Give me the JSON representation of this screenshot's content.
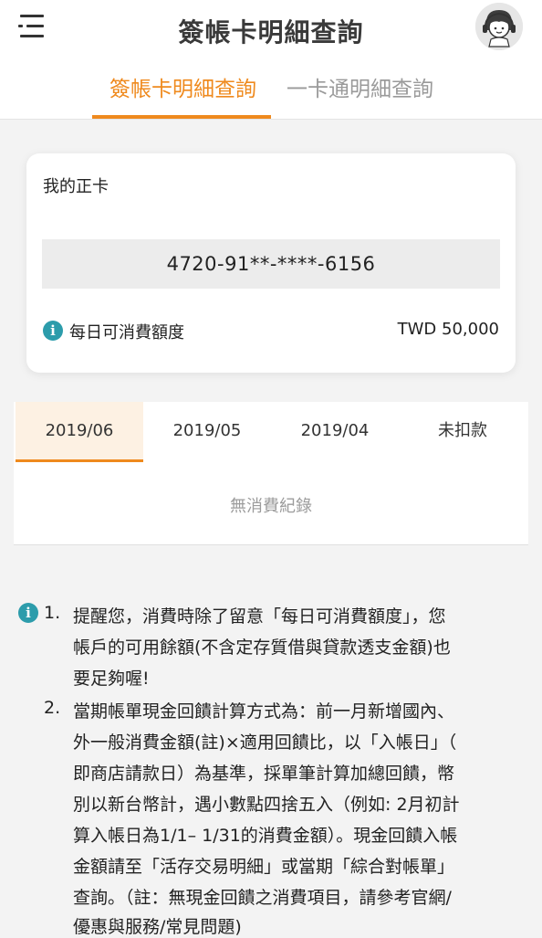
{
  "header": {
    "title": "簽帳卡明細查詢",
    "menu_icon": "menu-icon",
    "avatar_icon": "customer-service-avatar-icon"
  },
  "tabs": [
    {
      "label": "簽帳卡明細查詢",
      "active": true
    },
    {
      "label": "一卡通明細查詢",
      "active": false
    }
  ],
  "card": {
    "label": "我的正卡",
    "number": "4720-91**-****-6156",
    "limit_label": "每日可消費額度",
    "limit_value": "TWD 50,000"
  },
  "months": {
    "tabs": [
      "2019/06",
      "2019/05",
      "2019/04",
      "未扣款"
    ],
    "selected": "2019/06",
    "empty_text": "無消費紀錄"
  },
  "notes": {
    "item1": {
      "num": "1.",
      "lines": [
        "提醒您，消費時除了留意「每日可消費額度」，您",
        "帳戶的可用餘額(不含定存質借與貸款透支金額)也",
        "要足夠喔!"
      ]
    },
    "item2": {
      "num": "2.",
      "lines": [
        "當期帳單現金回饋計算方式為：前一月新增國內、",
        "外一般消費金額(註)×適用回饋比，以「入帳日」（",
        "即商店請款日）為基準，採單筆計算加總回饋，幣",
        "別以新台幣計，遇小數點四捨五入（例如: 2月初計",
        "算入帳日為1/1– 1/31的消費金額）。現金回饋入帳",
        "金額請至「活存交易明細」或當期「綜合對帳單」",
        "查詢。（註：無現金回饋之消費項目，請參考官網/",
        "優惠與服務/常見問題)"
      ]
    }
  },
  "colors": {
    "accent": "#ef8a1e",
    "info": "#2c9cab"
  }
}
